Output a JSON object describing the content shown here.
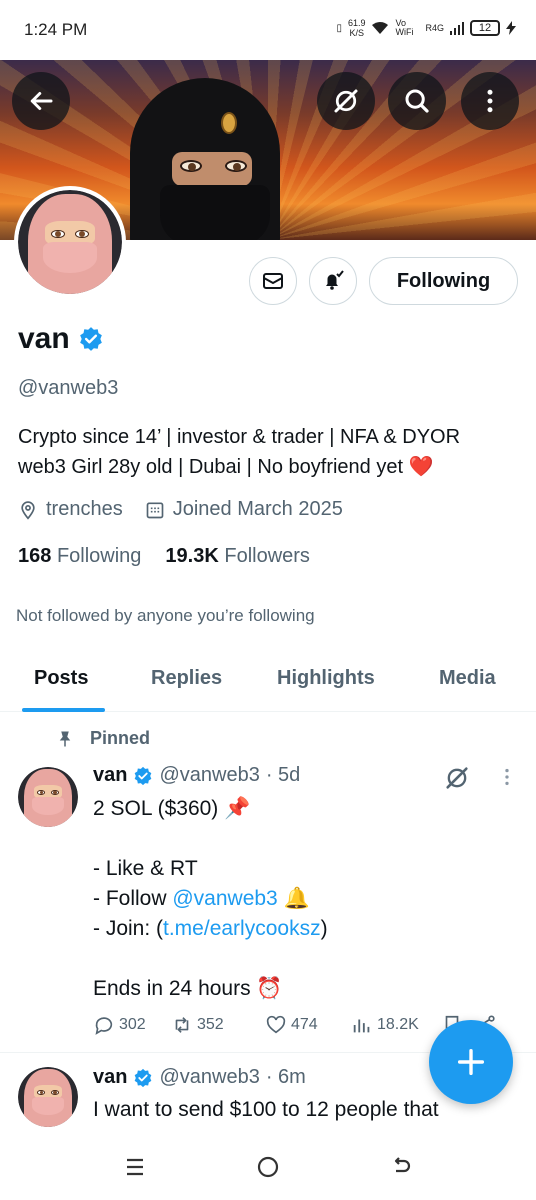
{
  "status_bar": {
    "time": "1:24 PM",
    "net_speed": "61.9",
    "net_unit": "K/S",
    "vowifi": "Vo WiFi",
    "network": "R4G",
    "battery": "12"
  },
  "header": {
    "back_icon": "back-arrow-icon",
    "grok_icon": "grok-icon",
    "search_icon": "search-icon",
    "more_icon": "more-vertical-icon"
  },
  "profile": {
    "name": "van",
    "handle": "@vanweb3",
    "bio_line1": "Crypto since 14’ | investor & trader | NFA & DYOR",
    "bio_line2": "web3 Girl 28y old | Dubai | No boyfriend yet ❤️",
    "location": "trenches",
    "joined": "Joined March 2025",
    "following_count": "168",
    "following_label": "Following",
    "followers_count": "19.3K",
    "followers_label": "Followers",
    "not_followed": "Not followed by anyone you’re following",
    "following_button": "Following"
  },
  "tabs": [
    {
      "label": "Posts",
      "active": true
    },
    {
      "label": "Replies",
      "active": false
    },
    {
      "label": "Highlights",
      "active": false
    },
    {
      "label": "Media",
      "active": false
    }
  ],
  "pinned_label": "Pinned",
  "posts": [
    {
      "name": "van",
      "handle": "@vanweb3",
      "time": "· 5d",
      "lines": {
        "l1": "2 SOL ($360) 📌",
        "l3": "- Like & RT",
        "l4_prefix": "- Follow ",
        "l4_link": "@vanweb3",
        "l4_suffix": " 🔔",
        "l5_prefix": "- Join: (",
        "l5_link": "t.me/earlycooksz",
        "l5_suffix": ")",
        "l7": "Ends in 24 hours ⏰"
      },
      "replies": "302",
      "reposts": "352",
      "likes": "474",
      "views": "18.2K"
    },
    {
      "name": "van",
      "handle": "@vanweb3",
      "time": "· 6m",
      "text": "I want to send $100 to 12 people that"
    }
  ],
  "colors": {
    "accent": "#1d9bf0",
    "text": "#0f1419",
    "muted": "#536471"
  }
}
